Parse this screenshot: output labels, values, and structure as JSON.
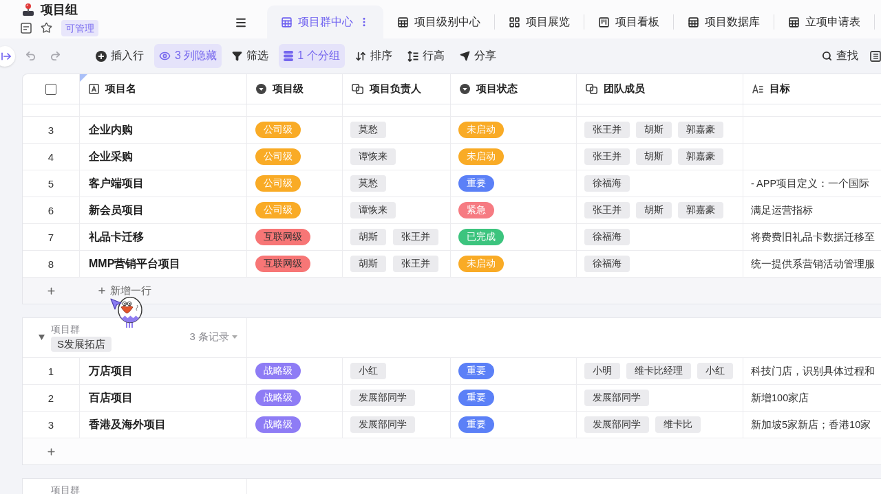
{
  "header": {
    "title": "项目组",
    "badge": "可管理"
  },
  "tabs": [
    {
      "label": "项目群中心",
      "kind": "grid",
      "selected": true
    },
    {
      "label": "项目级别中心",
      "kind": "grid",
      "selected": false
    },
    {
      "label": "项目展览",
      "kind": "gallery",
      "selected": false
    },
    {
      "label": "项目看板",
      "kind": "kanban",
      "selected": false
    },
    {
      "label": "项目数据库",
      "kind": "grid",
      "selected": false
    },
    {
      "label": "立项申请表",
      "kind": "grid",
      "selected": false
    }
  ],
  "toolbar": {
    "undo": {
      "disabled": true
    },
    "redo": {
      "disabled": true
    },
    "items": [
      {
        "label": "插入行",
        "kind": "insert",
        "active": false
      },
      {
        "label": "3 列隐藏",
        "kind": "hide",
        "active": true
      },
      {
        "label": "筛选",
        "kind": "filter",
        "active": false
      },
      {
        "label": "1 个分组",
        "kind": "group",
        "active": true
      },
      {
        "label": "排序",
        "kind": "sort",
        "active": false
      },
      {
        "label": "行高",
        "kind": "height",
        "active": false
      },
      {
        "label": "分享",
        "kind": "share",
        "active": false
      }
    ],
    "search": "查找"
  },
  "table": {
    "select_all": {
      "checked": false
    },
    "columns": [
      {
        "label": "项目名",
        "kind": "text"
      },
      {
        "label": "项目级",
        "kind": "select"
      },
      {
        "label": "项目负责人",
        "kind": "person"
      },
      {
        "label": "项目状态",
        "kind": "select"
      },
      {
        "label": "团队成员",
        "kind": "person"
      },
      {
        "label": "目标",
        "kind": "longtext"
      }
    ],
    "groups": [
      {
        "rows": [
          {
            "no": "3",
            "name": "企业内购",
            "level": {
              "label": "公司级",
              "color": "#f9ab26",
              "dark_label": false
            },
            "owners": [
              "莫愁"
            ],
            "status": {
              "label": "未启动",
              "color": "#f9ab26",
              "dark_label": false
            },
            "members": [
              "张王并",
              "胡斯",
              "郭嘉豪"
            ]
          },
          {
            "no": "4",
            "name": "企业采购",
            "level": {
              "label": "公司级",
              "color": "#f9ab26",
              "dark_label": false
            },
            "owners": [
              "谭恢来"
            ],
            "status": {
              "label": "未启动",
              "color": "#f9ab26",
              "dark_label": false
            },
            "members": [
              "张王并",
              "胡斯",
              "郭嘉豪"
            ]
          },
          {
            "no": "5",
            "name": "客户端项目",
            "level": {
              "label": "公司级",
              "color": "#f9ab26",
              "dark_label": false
            },
            "owners": [
              "莫愁"
            ],
            "status": {
              "label": "重要",
              "color": "#5b80f7",
              "dark_label": false
            },
            "members": [
              "徐福海"
            ],
            "goal": "- APP项目定义：一个国际"
          },
          {
            "no": "6",
            "name": "新会员项目",
            "level": {
              "label": "公司级",
              "color": "#f9ab26",
              "dark_label": false
            },
            "owners": [
              "谭恢来"
            ],
            "status": {
              "label": "紧急",
              "color": "#f67b82",
              "dark_label": false
            },
            "members": [
              "张王并",
              "胡斯",
              "郭嘉豪"
            ],
            "goal": "满足运营指标"
          },
          {
            "no": "7",
            "name": "礼品卡迁移",
            "level": {
              "label": "互联网级",
              "color": "#f77676",
              "dark_label": true
            },
            "owners": [
              "胡斯",
              "张王并"
            ],
            "status": {
              "label": "已完成",
              "color": "#3cc47e",
              "dark_label": false
            },
            "members": [
              "徐福海"
            ],
            "goal": "将费费旧礼品卡数据迁移至"
          },
          {
            "no": "8",
            "name": "MMP营销平台项目",
            "level": {
              "label": "互联网级",
              "color": "#f77676",
              "dark_label": true
            },
            "owners": [
              "胡斯",
              "张王并"
            ],
            "status": {
              "label": "未启动",
              "color": "#f9ab26",
              "dark_label": false
            },
            "members": [
              "徐福海"
            ],
            "goal": "统一提供系营销活动管理服"
          }
        ],
        "add_row_label": "新增一行"
      },
      {
        "header": {
          "field": "项目群",
          "value": "S发展拓店",
          "count": "3 条记录",
          "expanded": true
        },
        "rows": [
          {
            "no": "1",
            "name": "万店项目",
            "level": {
              "label": "战略级",
              "color": "#8e7cf5",
              "dark_label": false
            },
            "owners": [
              "小红"
            ],
            "status": {
              "label": "重要",
              "color": "#5b80f7",
              "dark_label": false
            },
            "members": [
              "小明",
              "维卡比经理",
              "小红"
            ],
            "goal": "科技门店，识别具体过程和"
          },
          {
            "no": "2",
            "name": "百店项目",
            "level": {
              "label": "战略级",
              "color": "#8e7cf5",
              "dark_label": false
            },
            "owners": [
              "发展部同学"
            ],
            "status": {
              "label": "重要",
              "color": "#5b80f7",
              "dark_label": false
            },
            "members": [
              "发展部同学"
            ],
            "goal": "新增100家店"
          },
          {
            "no": "3",
            "name": "香港及海外项目",
            "level": {
              "label": "战略级",
              "color": "#8e7cf5",
              "dark_label": false
            },
            "owners": [
              "发展部同学"
            ],
            "status": {
              "label": "重要",
              "color": "#5b80f7",
              "dark_label": false
            },
            "members": [
              "发展部同学",
              "维卡比"
            ],
            "goal": "新加坡5家新店；香港10家"
          }
        ]
      },
      {
        "header": {
          "field": "项目群"
        }
      }
    ]
  }
}
